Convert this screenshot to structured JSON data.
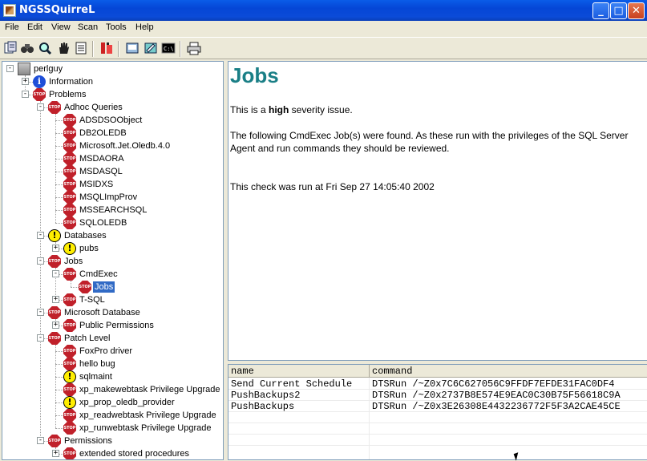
{
  "window": {
    "title": "NGSSQuirreL"
  },
  "menu": [
    "File",
    "Edit",
    "View",
    "Scan",
    "Tools",
    "Help"
  ],
  "tree": [
    {
      "label": "perlguy",
      "icon": "computer-icon",
      "level": 0,
      "expander": "-",
      "row": 0
    },
    {
      "label": "Information",
      "icon": "info-icon",
      "level": 1,
      "expander": "+",
      "row": 1
    },
    {
      "label": "Problems",
      "icon": "stop-icon",
      "level": 1,
      "expander": "-",
      "row": 2
    },
    {
      "label": "Adhoc Queries",
      "icon": "stop-icon",
      "level": 2,
      "expander": "-",
      "row": 3
    },
    {
      "label": "ADSDSOObject",
      "icon": "stop-icon",
      "level": 3,
      "expander": "",
      "row": 4
    },
    {
      "label": "DB2OLEDB",
      "icon": "stop-icon",
      "level": 3,
      "expander": "",
      "row": 5
    },
    {
      "label": "Microsoft.Jet.Oledb.4.0",
      "icon": "stop-icon",
      "level": 3,
      "expander": "",
      "row": 6
    },
    {
      "label": "MSDAORA",
      "icon": "stop-icon",
      "level": 3,
      "expander": "",
      "row": 7
    },
    {
      "label": "MSDASQL",
      "icon": "stop-icon",
      "level": 3,
      "expander": "",
      "row": 8
    },
    {
      "label": "MSIDXS",
      "icon": "stop-icon",
      "level": 3,
      "expander": "",
      "row": 9
    },
    {
      "label": "MSQLImpProv",
      "icon": "stop-icon",
      "level": 3,
      "expander": "",
      "row": 10
    },
    {
      "label": "MSSEARCHSQL",
      "icon": "stop-icon",
      "level": 3,
      "expander": "",
      "row": 11
    },
    {
      "label": "SQLOLEDB",
      "icon": "stop-icon",
      "level": 3,
      "expander": "",
      "row": 12
    },
    {
      "label": "Databases",
      "icon": "warning-icon",
      "level": 2,
      "expander": "-",
      "row": 13
    },
    {
      "label": "pubs",
      "icon": "warning-icon",
      "level": 3,
      "expander": "+",
      "row": 14
    },
    {
      "label": "Jobs",
      "icon": "stop-icon",
      "level": 2,
      "expander": "-",
      "row": 15
    },
    {
      "label": "CmdExec",
      "icon": "stop-icon",
      "level": 3,
      "expander": "-",
      "row": 16
    },
    {
      "label": "Jobs",
      "icon": "stop-icon",
      "level": 4,
      "expander": "",
      "row": 17,
      "selected": true
    },
    {
      "label": "T-SQL",
      "icon": "stop-icon",
      "level": 3,
      "expander": "+",
      "row": 18
    },
    {
      "label": "Microsoft Database",
      "icon": "stop-icon",
      "level": 2,
      "expander": "-",
      "row": 19
    },
    {
      "label": "Public Permissions",
      "icon": "stop-icon",
      "level": 3,
      "expander": "+",
      "row": 20
    },
    {
      "label": "Patch Level",
      "icon": "stop-icon",
      "level": 2,
      "expander": "-",
      "row": 21
    },
    {
      "label": "FoxPro driver",
      "icon": "stop-icon",
      "level": 3,
      "expander": "",
      "row": 22
    },
    {
      "label": "hello bug",
      "icon": "stop-icon",
      "level": 3,
      "expander": "",
      "row": 23
    },
    {
      "label": "sqlmaint",
      "icon": "warning-icon",
      "level": 3,
      "expander": "",
      "row": 24
    },
    {
      "label": "xp_makewebtask Privilege Upgrade",
      "icon": "stop-icon",
      "level": 3,
      "expander": "",
      "row": 25
    },
    {
      "label": "xp_prop_oledb_provider",
      "icon": "warning-icon",
      "level": 3,
      "expander": "",
      "row": 26
    },
    {
      "label": "xp_readwebtask Privilege Upgrade",
      "icon": "stop-icon",
      "level": 3,
      "expander": "",
      "row": 27
    },
    {
      "label": "xp_runwebtask Privilege Upgrade",
      "icon": "stop-icon",
      "level": 3,
      "expander": "",
      "row": 28
    },
    {
      "label": "Permissions",
      "icon": "stop-icon",
      "level": 2,
      "expander": "-",
      "row": 29
    },
    {
      "label": "extended stored procedures",
      "icon": "stop-icon",
      "level": 3,
      "expander": "+",
      "row": 30
    }
  ],
  "detail": {
    "heading": "Jobs",
    "severity_prefix": "This is a ",
    "severity": "high",
    "severity_suffix": " severity issue.",
    "description": "The following CmdExec Job(s) were found. As these run with the privileges of the SQL Server Agent and run commands they should be reviewed.",
    "check_time": "This check was run at Fri Sep 27 14:05:40 2002"
  },
  "table": {
    "columns": [
      "name",
      "command"
    ],
    "rows": [
      [
        "Send Current Schedule",
        "DTSRun /~Z0x7C6C627056C9FFDF7EFDE31FAC0DF4"
      ],
      [
        "PushBackups2",
        "DTSRun /~Z0x2737B8E574E9EAC0C30B75F56618C9A"
      ],
      [
        "PushBackups",
        "DTSRun /~Z0x3E26308E4432236772F5F3A2CAE45CE"
      ]
    ]
  },
  "stop_text": "STOP"
}
